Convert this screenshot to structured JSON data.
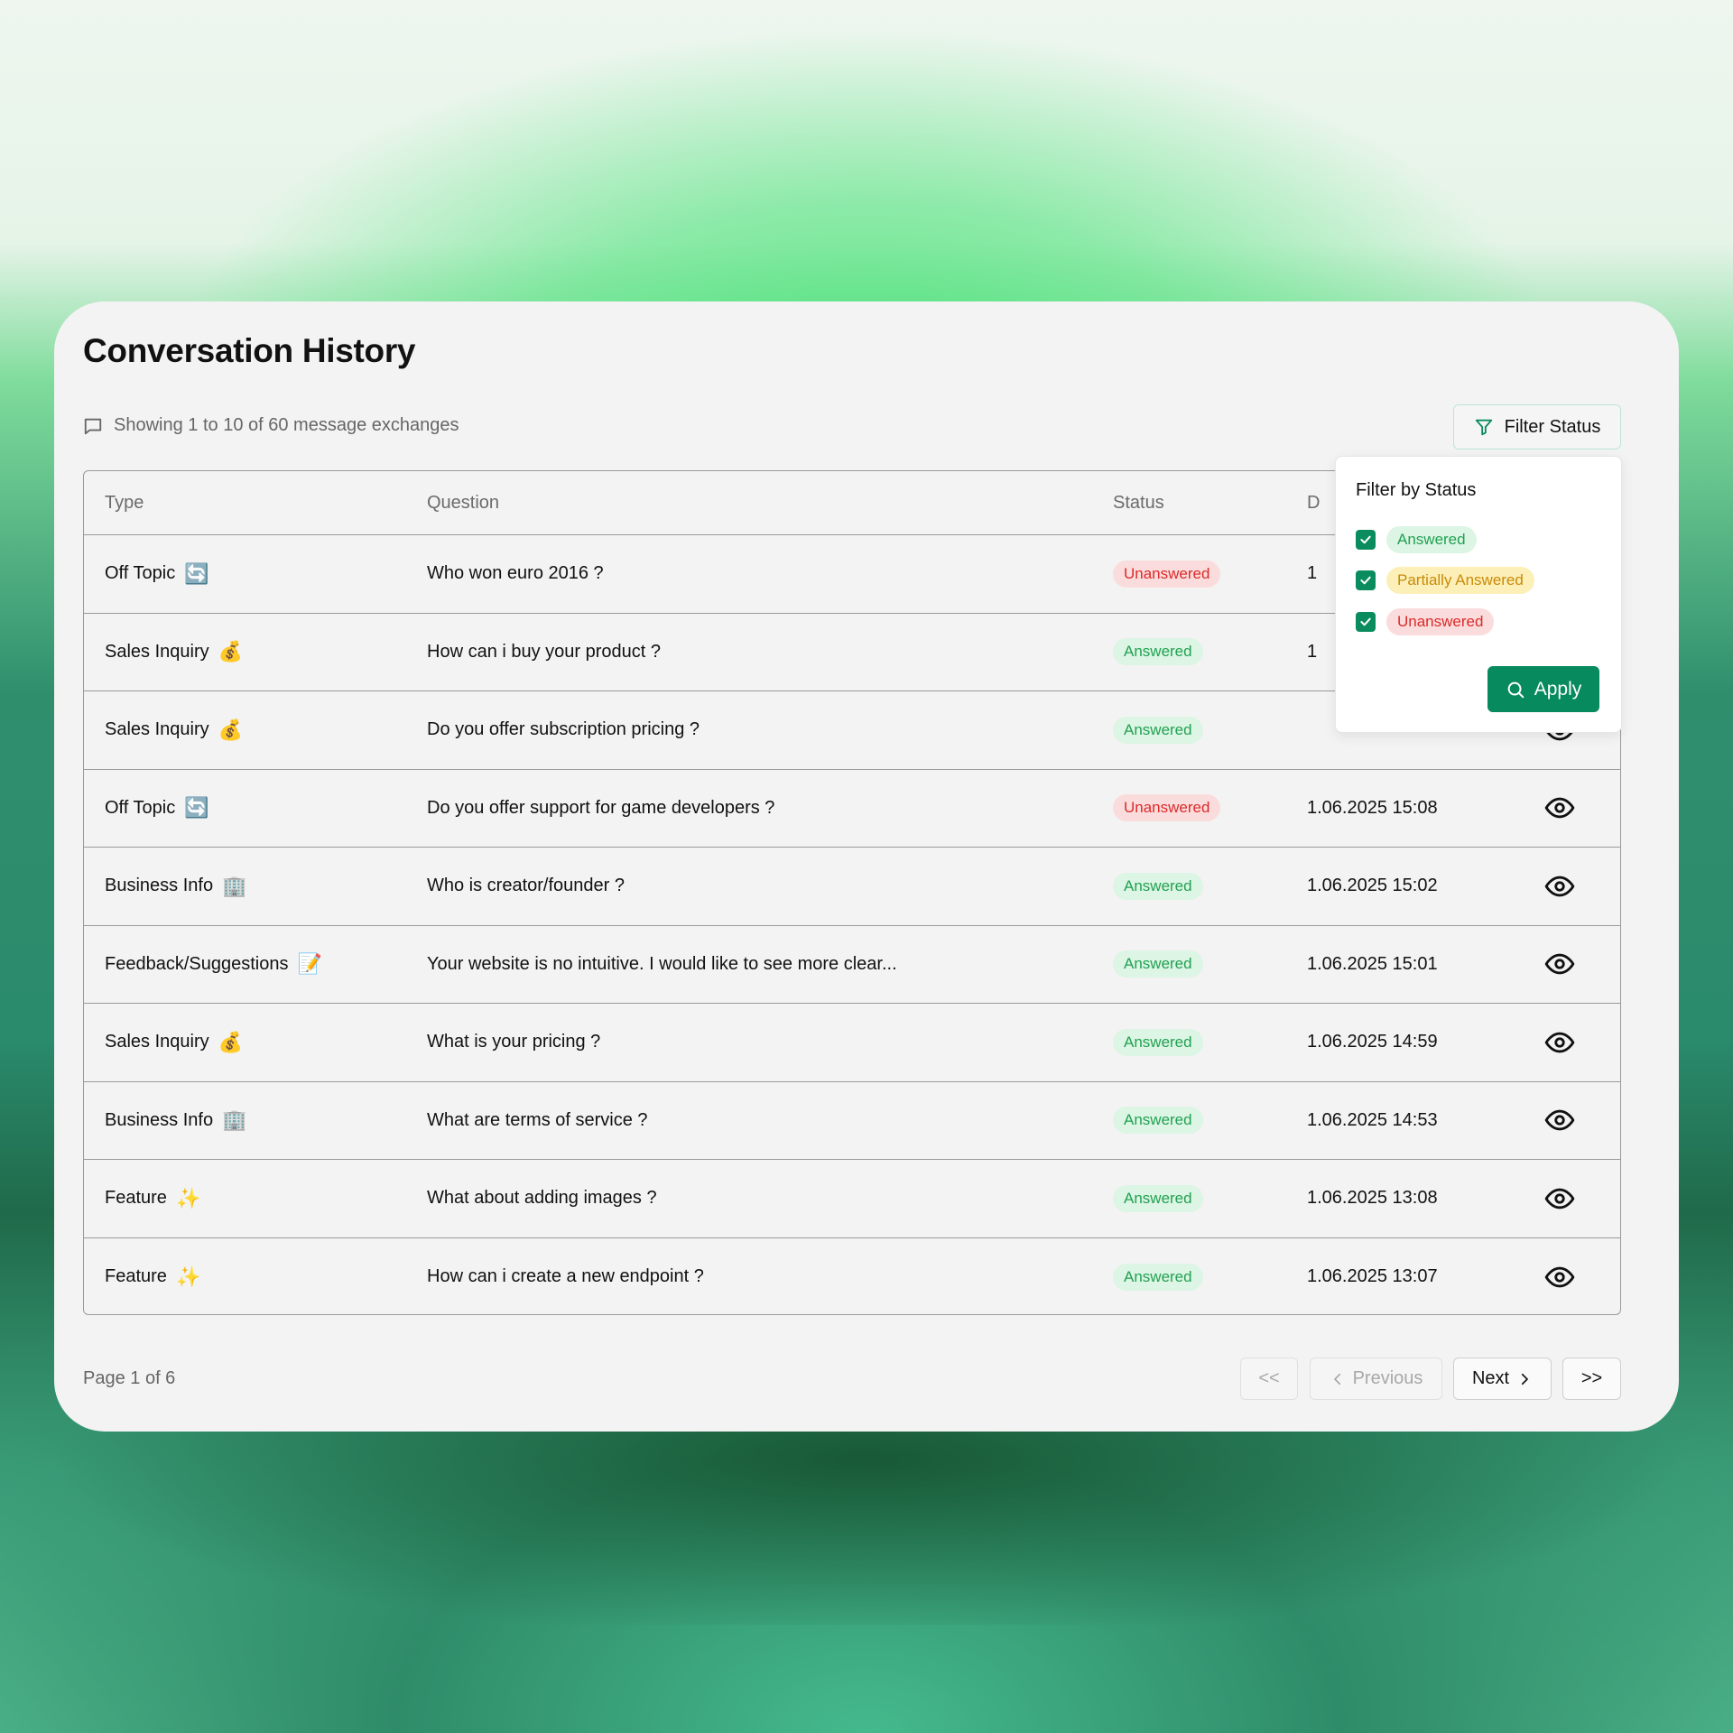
{
  "page": {
    "title": "Conversation History",
    "summary": "Showing 1 to 10 of 60 message exchanges"
  },
  "filter": {
    "button_label": "Filter Status",
    "popover_title": "Filter by Status",
    "options": [
      {
        "label": "Answered",
        "checked": true,
        "style": "answered"
      },
      {
        "label": "Partially Answered",
        "checked": true,
        "style": "partial"
      },
      {
        "label": "Unanswered",
        "checked": true,
        "style": "unanswered"
      }
    ],
    "apply_label": "Apply"
  },
  "table": {
    "columns": [
      "Type",
      "Question",
      "Status",
      "D"
    ],
    "rows": [
      {
        "type": "Off Topic",
        "emoji": "🔄",
        "question": "Who won euro 2016 ?",
        "status": "Unanswered",
        "date": "1"
      },
      {
        "type": "Sales Inquiry",
        "emoji": "💰",
        "question": "How can i buy your product ?",
        "status": "Answered",
        "date": "1"
      },
      {
        "type": "Sales Inquiry",
        "emoji": "💰",
        "question": "Do you offer subscription pricing ?",
        "status": "Answered",
        "date": ""
      },
      {
        "type": "Off Topic",
        "emoji": "🔄",
        "question": "Do you offer support for game developers ?",
        "status": "Unanswered",
        "date": "1.06.2025 15:08"
      },
      {
        "type": "Business Info",
        "emoji": "🏢",
        "question": "Who is creator/founder ?",
        "status": "Answered",
        "date": "1.06.2025 15:02"
      },
      {
        "type": "Feedback/Suggestions",
        "emoji": "📝",
        "question": "Your website is no intuitive. I would like to see more clear...",
        "status": "Answered",
        "date": "1.06.2025 15:01"
      },
      {
        "type": "Sales Inquiry",
        "emoji": "💰",
        "question": "What is your pricing ?",
        "status": "Answered",
        "date": "1.06.2025 14:59"
      },
      {
        "type": "Business Info",
        "emoji": "🏢",
        "question": "What are terms of service ?",
        "status": "Answered",
        "date": "1.06.2025 14:53"
      },
      {
        "type": "Feature",
        "emoji": "✨",
        "question": "What about adding images ?",
        "status": "Answered",
        "date": "1.06.2025 13:08"
      },
      {
        "type": "Feature",
        "emoji": "✨",
        "question": "How can i create a new endpoint ?",
        "status": "Answered",
        "date": "1.06.2025 13:07"
      }
    ]
  },
  "pagination": {
    "page_label": "Page 1 of 6",
    "first_label": "<<",
    "prev_label": "Previous",
    "next_label": "Next",
    "last_label": ">>"
  },
  "colors": {
    "accent": "#078a5d",
    "answered_bg": "#dcf5e4",
    "answered_text": "#22a152",
    "unanswered_bg": "#fbdcdc",
    "unanswered_text": "#dc2a2a",
    "partial_bg": "#fcf0b8",
    "partial_text": "#c98a07"
  },
  "icons": {
    "summary": "message-square-icon",
    "filter": "funnel-icon",
    "view": "eye-icon",
    "apply": "search-icon",
    "check": "checkmark-icon"
  }
}
